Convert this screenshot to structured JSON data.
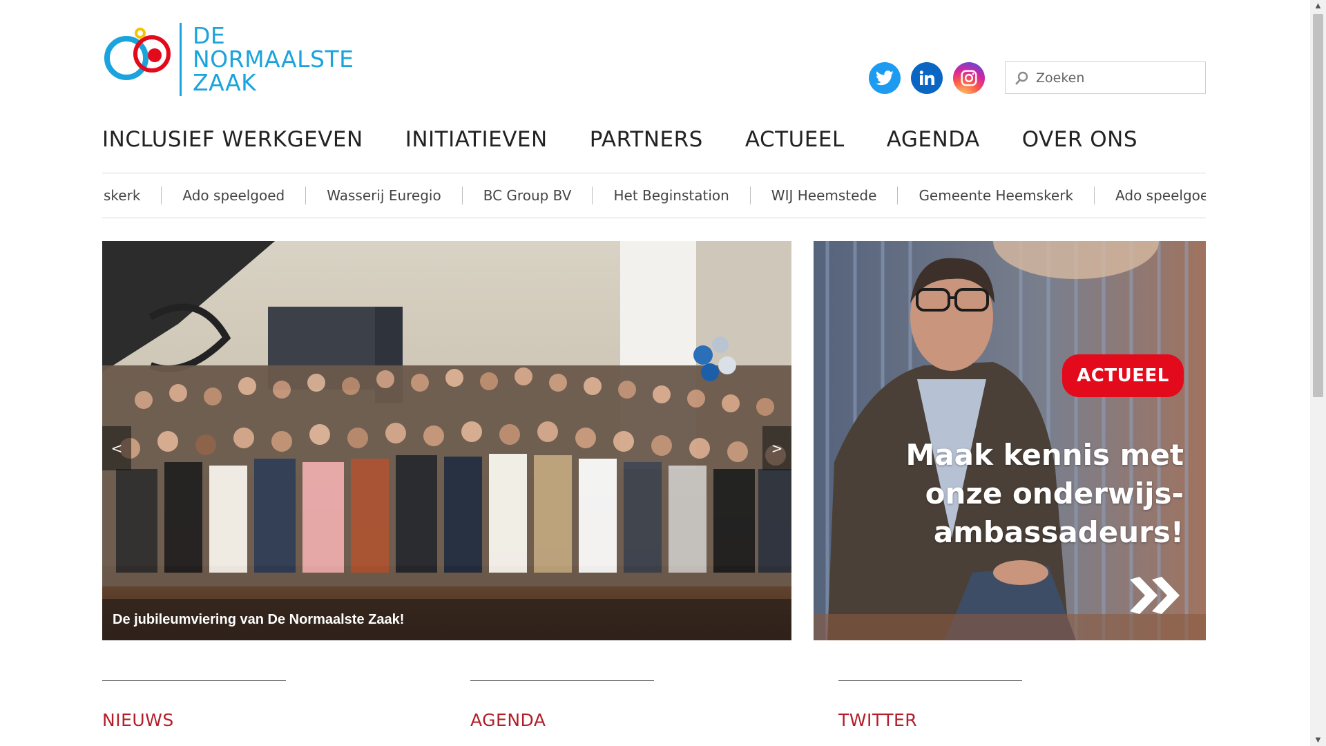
{
  "logo": {
    "line1": "DE",
    "line2": "NORMAALSTE",
    "line3": "ZAAK"
  },
  "social": [
    "twitter-icon",
    "linkedin-icon",
    "instagram-icon"
  ],
  "search": {
    "placeholder": "Zoeken"
  },
  "nav": [
    "INCLUSIEF WERKGEVEN",
    "INITIATIEVEN",
    "PARTNERS",
    "ACTUEEL",
    "AGENDA",
    "OVER ONS"
  ],
  "ticker": [
    "skerk",
    "Ado speelgoed",
    "Wasserij Euregio",
    "BC Group BV",
    "Het Beginstation",
    "WIJ Heemstede",
    "Gemeente Heemskerk",
    "Ado speelgoed"
  ],
  "slider": {
    "prev": "<",
    "next": ">",
    "caption": "De jubileumviering van De Normaalste Zaak!"
  },
  "promo": {
    "badge": "ACTUEEL",
    "line1": "Maak kennis met",
    "line2": "onze onderwijs-",
    "line3": "ambassadeurs!"
  },
  "sections": [
    "NIEUWS",
    "AGENDA",
    "TWITTER"
  ],
  "colors": {
    "brand_blue": "#1aa3dd",
    "brand_red": "#e30a1c",
    "section_red": "#b31e2a"
  }
}
